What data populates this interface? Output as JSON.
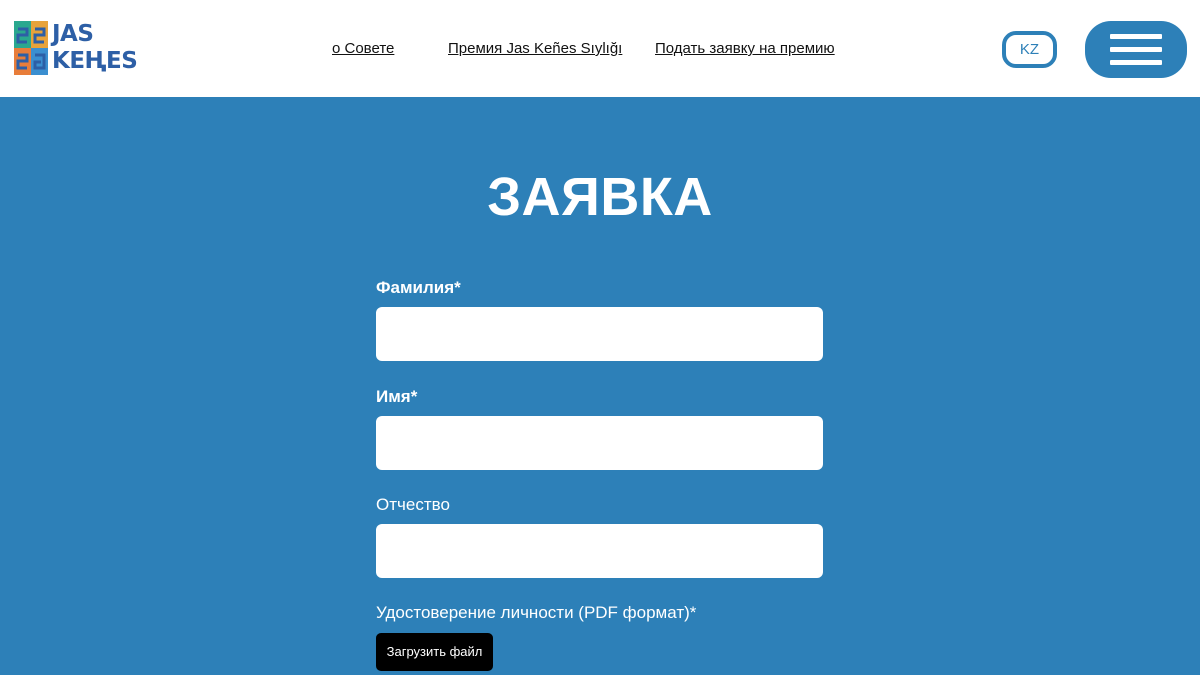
{
  "logo": {
    "line1": "JAS",
    "line2": "KEҢES"
  },
  "nav": [
    {
      "label": "о Совете"
    },
    {
      "label": "Премия Jas Keñes Sıylığı"
    },
    {
      "label": "Подать заявку на премию"
    }
  ],
  "lang": {
    "label": "KZ"
  },
  "page": {
    "title": "ЗАЯВКА"
  },
  "form": {
    "surname_label": "Фамилия*",
    "name_label": "Имя*",
    "patronymic_label": "Отчество",
    "id_label": "Удостоверение личности (PDF формат)*",
    "upload_label": "Загрузить файл"
  },
  "colors": {
    "brand_blue": "#2d80b8",
    "logo_blue": "#2d5fa6"
  }
}
